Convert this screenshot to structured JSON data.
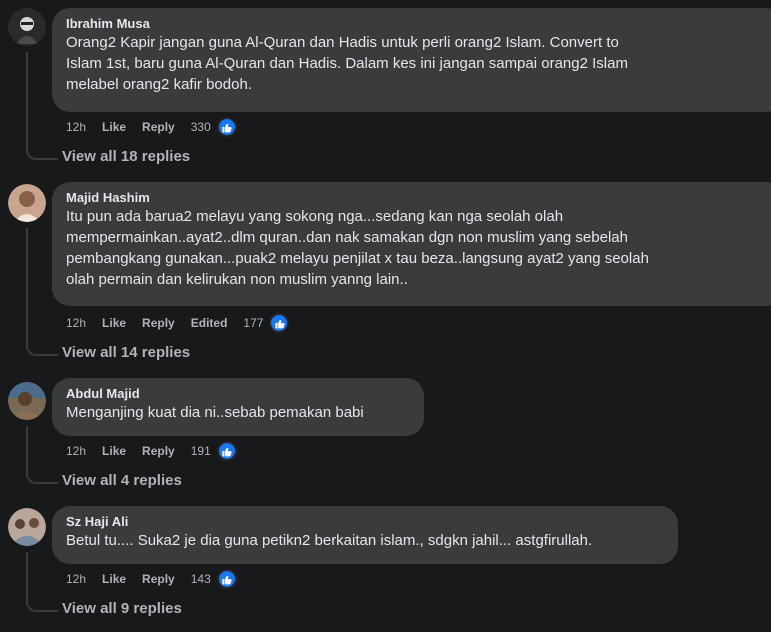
{
  "comments": [
    {
      "author": "Ibrahim Musa",
      "lines": [
        "Orang2 Kapir jangan guna Al-Quran dan Hadis untuk perli orang2 Islam. Convert to",
        "Islam 1st, baru guna Al-Quran dan Hadis. Dalam kes ini jangan sampai orang2 Islam",
        "melabel orang2 kafir bodoh."
      ],
      "time": "12h",
      "like": "Like",
      "reply": "Reply",
      "edited": "",
      "reactions": "330",
      "view_replies": "View all 18 replies",
      "avatar_color": "#2b2b2b"
    },
    {
      "author": "Majid Hashim",
      "lines": [
        "Itu pun ada barua2 melayu yang sokong nga...sedang kan nga seolah olah",
        "mempermainkan..ayat2..dlm quran..dan nak samakan dgn non muslim yang sebelah",
        "pembangkang gunakan...puak2 melayu penjilat x tau beza..langsung ayat2 yang seolah",
        "olah permain dan kelirukan non muslim yanng lain.."
      ],
      "time": "12h",
      "like": "Like",
      "reply": "Reply",
      "edited": "Edited",
      "reactions": "177",
      "view_replies": "View all 14 replies",
      "avatar_color": "#a47c6a"
    },
    {
      "author": "Abdul Majid",
      "lines": [
        "Menganjing kuat dia ni..sebab pemakan babi"
      ],
      "time": "12h",
      "like": "Like",
      "reply": "Reply",
      "edited": "",
      "reactions": "191",
      "view_replies": "View all 4 replies",
      "avatar_color": "#6b5a44"
    },
    {
      "author": "Sz Haji Ali",
      "lines": [
        "Betul tu.... Suka2 je dia guna petikn2 berkaitan islam., sdgkn jahil... astgfirullah."
      ],
      "time": "12h",
      "like": "Like",
      "reply": "Reply",
      "edited": "",
      "reactions": "143",
      "view_replies": "View all 9 replies",
      "avatar_color": "#9a8a7c"
    }
  ],
  "colors": {
    "background": "#18191a",
    "bubble": "#3a3b3c",
    "text": "#e4e6eb",
    "secondary": "#b0b3b8",
    "like_blue": "#1877f2"
  },
  "icons": {
    "reaction": "thumbs-up-icon"
  }
}
